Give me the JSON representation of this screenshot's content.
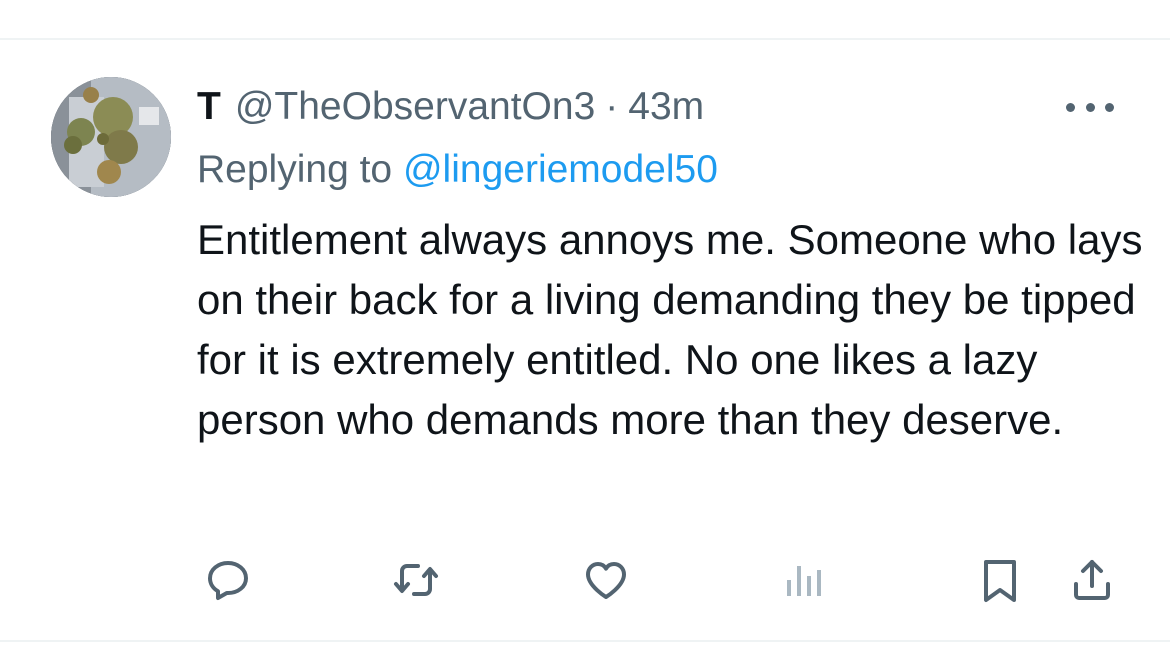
{
  "tweet": {
    "display_name": "T",
    "handle": "@TheObservantOn3",
    "separator": "·",
    "time": "43m",
    "reply_prefix": "Replying to",
    "reply_to": "@lingeriemodel50",
    "text": "Entitlement always annoys me. Someone who lays on their back for a living demanding they be tipped for it is extremely entitled. No one likes a lazy person who demands more than they deserve."
  },
  "icons": {
    "avatar": "profile-photo",
    "more": "more-options-icon",
    "reply": "reply-icon",
    "retweet": "retweet-icon",
    "like": "heart-icon",
    "views": "analytics-icon",
    "bookmark": "bookmark-icon",
    "share": "share-icon"
  },
  "colors": {
    "text": "#0f1419",
    "secondary": "#536471",
    "link": "#1d9bf0",
    "divider": "#eff3f4",
    "disabled": "#aab8c2"
  }
}
